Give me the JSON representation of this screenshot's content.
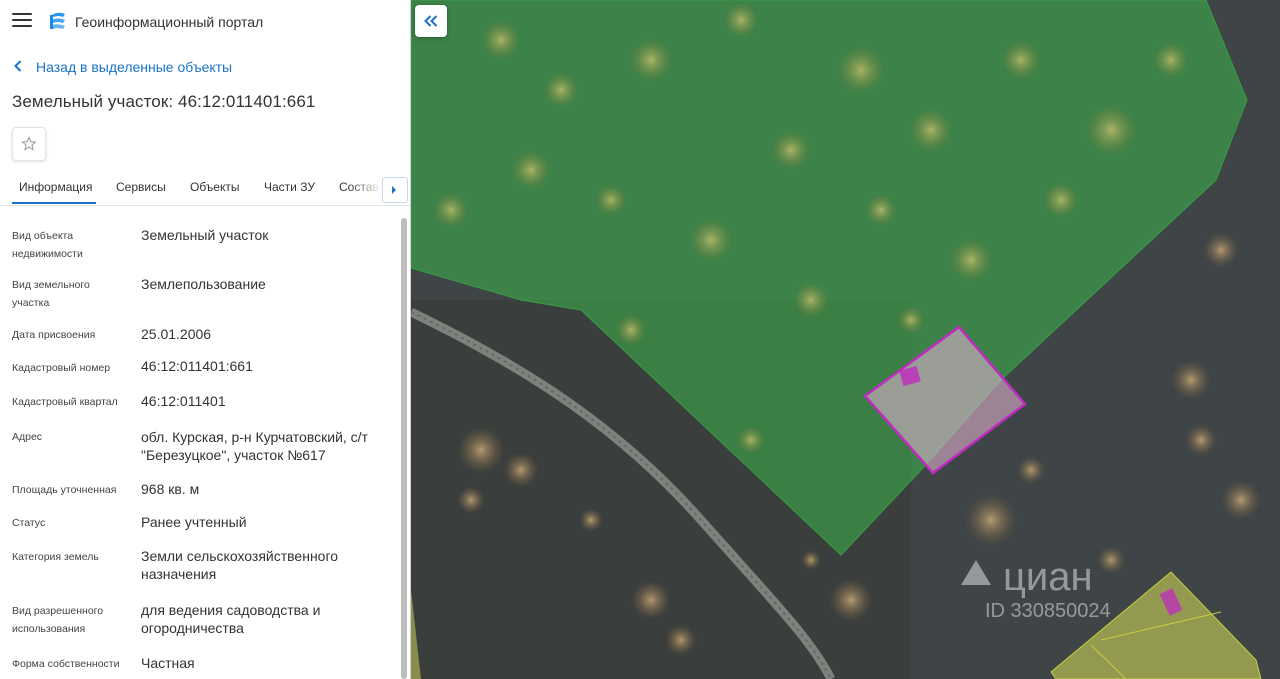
{
  "header": {
    "title": "Геоинформационный портал"
  },
  "back_link": "Назад в выделенные объекты",
  "object_title": "Земельный участок: 46:12:011401:661",
  "tabs": [
    "Информация",
    "Сервисы",
    "Объекты",
    "Части ЗУ",
    "Состав"
  ],
  "active_tab": "Информация",
  "attributes": [
    {
      "label": "Вид объекта недвижимости",
      "value": "Земельный участок"
    },
    {
      "label": "Вид земельного участка",
      "value": "Землепользование"
    },
    {
      "label": "Дата присвоения",
      "value": "25.01.2006"
    },
    {
      "label": "Кадастровый номер",
      "value": "46:12:011401:661"
    },
    {
      "label": "Кадастровый квартал",
      "value": "46:12:011401"
    },
    {
      "label": "Адрес",
      "value": "обл. Курская, р-н Курчатовский, с/т \"Березуцкое\", участок №617"
    },
    {
      "label": "Площадь уточненная",
      "value": "968 кв. м"
    },
    {
      "label": "Статус",
      "value": "Ранее учтенный"
    },
    {
      "label": "Категория земель",
      "value": "Земли сельскохозяйственного назначения"
    },
    {
      "label": "Вид разрешенного использования",
      "value": "для ведения садоводства и огородничества"
    },
    {
      "label": "Форма собственности",
      "value": "Частная"
    }
  ],
  "map": {
    "watermark_brand": "циан",
    "watermark_id": "ID 330850024"
  },
  "colors": {
    "accent": "#1a73c8",
    "parcel_outline": "#c02bc0",
    "zone_green": "#3cb44a",
    "zone_yellow": "#d8e05a"
  },
  "icons": [
    "menu-icon",
    "portal-logo-icon",
    "chevron-left-icon",
    "star-icon",
    "chevron-right-icon",
    "double-chevron-left-icon"
  ]
}
